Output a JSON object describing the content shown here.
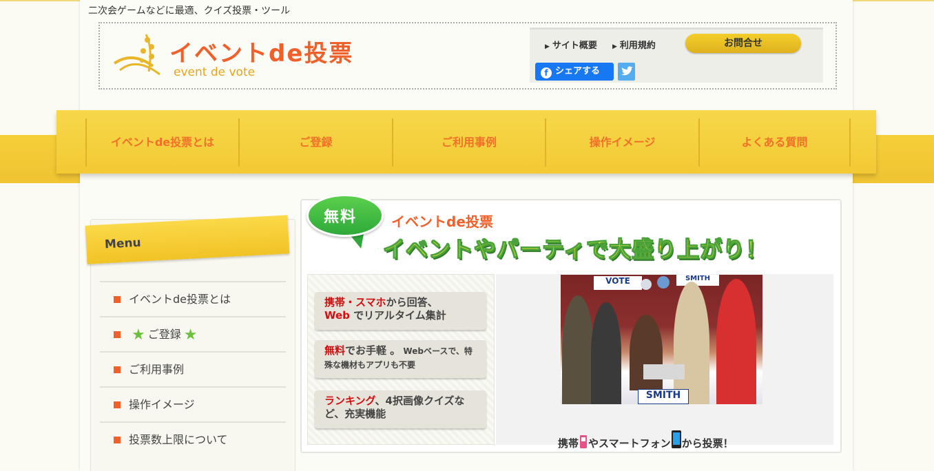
{
  "tagline": "二次会ゲームなどに最適、クイズ投票・ツール",
  "logo": {
    "title": "イベントde投票",
    "subtitle": "event de vote"
  },
  "header": {
    "links": [
      "サイト概要",
      "利用規約"
    ],
    "contact_label": "お問合せ",
    "facebook_label": "シェアする"
  },
  "nav": {
    "items": [
      "イベントde投票とは",
      "ご登録",
      "ご利用事例",
      "操作イメージ",
      "よくある質問"
    ]
  },
  "sidebar": {
    "menu_title": "Menu",
    "items": [
      "イベントde投票とは",
      "ご登録",
      "ご利用事例",
      "操作イメージ",
      "投票数上限について"
    ]
  },
  "banner": {
    "bubble": "無料",
    "small": "イベントde投票",
    "big": "イベントやパーティで大盛り上がり！"
  },
  "features": [
    {
      "red1": "携帯・スマホ",
      "text1": "から回答、",
      "red2": "Web",
      "text2": " でリアルタイム集計"
    },
    {
      "red1": "無料",
      "text1": "でお手軽 。",
      "small": " Webベースで、特殊な機材もアプリも不要"
    },
    {
      "red1": "ランキング",
      "text1": "、4択画像クイズなど、充実機能"
    }
  ],
  "photo": {
    "caption_a": "携帯",
    "caption_b": "やスマートフォン",
    "caption_c": "から投票！",
    "sign_top": "VOTE",
    "sign_top2": "SMITH",
    "sign_bottom": "SMITH"
  },
  "colors": {
    "accent": "#f0602a",
    "nav_yellow": "#f6cf3a",
    "green": "#2fa93a"
  }
}
